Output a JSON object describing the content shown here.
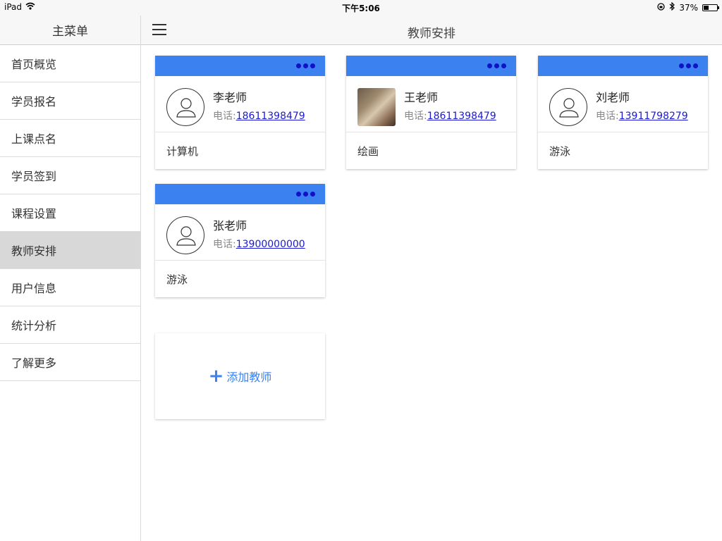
{
  "status_bar": {
    "device": "iPad",
    "time": "下午5:06",
    "battery": "37%"
  },
  "sidebar": {
    "title": "主菜单",
    "items": [
      {
        "label": "首页概览",
        "active": false
      },
      {
        "label": "学员报名",
        "active": false
      },
      {
        "label": "上课点名",
        "active": false
      },
      {
        "label": "学员签到",
        "active": false
      },
      {
        "label": "课程设置",
        "active": false
      },
      {
        "label": "教师安排",
        "active": true
      },
      {
        "label": "用户信息",
        "active": false
      },
      {
        "label": "统计分析",
        "active": false
      },
      {
        "label": "了解更多",
        "active": false
      }
    ]
  },
  "header": {
    "title": "教师安排"
  },
  "teachers": [
    {
      "name": "李老师",
      "phone_label": "电话:",
      "phone": "18611398479",
      "subject": "计算机",
      "avatar": "default-avatar-icon"
    },
    {
      "name": "王老师",
      "phone_label": "电话:",
      "phone": "18611398479",
      "subject": "绘画",
      "avatar": "photo"
    },
    {
      "name": "刘老师",
      "phone_label": "电话:",
      "phone": "13911798279",
      "subject": "游泳",
      "avatar": "default-avatar-icon"
    },
    {
      "name": "张老师",
      "phone_label": "电话:",
      "phone": "13900000000",
      "subject": "游泳",
      "avatar": "default-avatar-icon"
    }
  ],
  "add_teacher": {
    "label": "添加教师"
  },
  "colors": {
    "card_header": "#3b82f0",
    "dots": "#1111c8",
    "link": "#1a1ad4",
    "active_menu": "#d8d8d8"
  }
}
